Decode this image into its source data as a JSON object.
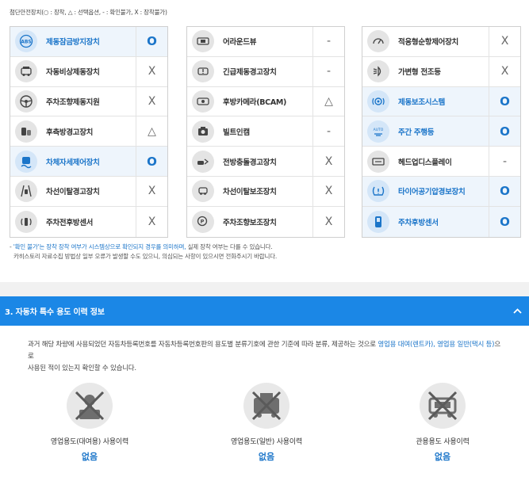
{
  "legend": "첨단안전장치(○ : 장착, △ : 선택옵션, - : 확인불가, X : 장착불가)",
  "columns": [
    {
      "items": [
        {
          "name": "제동잠금방지장치",
          "mark": "O",
          "icon": "abs-icon",
          "highlight": true
        },
        {
          "name": "자동비상제동장치",
          "mark": "X",
          "icon": "emergency-brake-icon",
          "highlight": false
        },
        {
          "name": "주차조향제동지원",
          "mark": "X",
          "icon": "steering-icon",
          "highlight": false
        },
        {
          "name": "후측방경고장치",
          "mark": "△",
          "icon": "rear-side-warning-icon",
          "highlight": false
        },
        {
          "name": "차체자세제어장치",
          "mark": "O",
          "icon": "stability-control-icon",
          "highlight": true
        },
        {
          "name": "차선이탈경고장치",
          "mark": "X",
          "icon": "lane-warning-icon",
          "highlight": false
        },
        {
          "name": "주차전후방센서",
          "mark": "X",
          "icon": "parking-sensor-icon",
          "highlight": false
        }
      ]
    },
    {
      "items": [
        {
          "name": "어라운드뷰",
          "mark": "-",
          "icon": "around-view-icon",
          "highlight": false
        },
        {
          "name": "긴급제동경고장치",
          "mark": "-",
          "icon": "emergency-warning-icon",
          "highlight": false
        },
        {
          "name": "후방카메라(BCAM)",
          "mark": "△",
          "icon": "rear-camera-icon",
          "highlight": false
        },
        {
          "name": "빌트인캠",
          "mark": "-",
          "icon": "builtin-cam-icon",
          "highlight": false
        },
        {
          "name": "전방충돌경고장치",
          "mark": "X",
          "icon": "forward-collision-icon",
          "highlight": false
        },
        {
          "name": "차선이탈보조장치",
          "mark": "X",
          "icon": "lane-assist-icon",
          "highlight": false
        },
        {
          "name": "주차조향보조장치",
          "mark": "X",
          "icon": "parking-assist-icon",
          "highlight": false
        }
      ]
    },
    {
      "items": [
        {
          "name": "적응형순항제어장치",
          "mark": "X",
          "icon": "cruise-control-icon",
          "highlight": false
        },
        {
          "name": "가변형 전조등",
          "mark": "X",
          "icon": "headlamp-icon",
          "highlight": false
        },
        {
          "name": "제동보조시스템",
          "mark": "O",
          "icon": "brake-assist-icon",
          "highlight": true
        },
        {
          "name": "주간 주행등",
          "mark": "O",
          "icon": "daytime-light-icon",
          "highlight": true
        },
        {
          "name": "헤드업디스플레이",
          "mark": "-",
          "icon": "hud-icon",
          "highlight": false
        },
        {
          "name": "타이어공기압경보장치",
          "mark": "O",
          "icon": "tpms-icon",
          "highlight": true
        },
        {
          "name": "주차후방센서",
          "mark": "O",
          "icon": "rear-sensor-icon",
          "highlight": true
        }
      ]
    }
  ],
  "notes": {
    "line1_prefix": "- ",
    "line1_blue": "'확인 불가'는 장착 장착 여부가 시스템상으로 확인되지 경우를 의미하며,",
    "line1_rest": " 실제 장착 여부는 다를 수 있습니다.",
    "line2": "카히스토리 자료수집 방법상 일부 오류가 발생할 수도 있으니, 의심되는 사항이 있으시면 전화주시기 바랍니다."
  },
  "section": {
    "title": "3. 자동차 특수 용도 이력 정보",
    "desc_part1": "과거 해당 차량에 사용되었던 자동차등록번호를 자동차등록번호판의 용도별 분류기호에 관한 기준에 따라 분류, 제공하는 것으로 ",
    "desc_blue": "영업용 대여(렌트카), 영업용 일반(택시 등)",
    "desc_part2": "으로",
    "desc_line2": "사용된 적이 있는지 확인할 수 있습니다."
  },
  "usage": [
    {
      "label": "영업용도(대여용) 사용이력",
      "value": "없음",
      "icon": "rental-key-icon"
    },
    {
      "label": "영업용도(일반) 사용이력",
      "value": "없음",
      "icon": "taxi-icon"
    },
    {
      "label": "관용용도 사용이력",
      "value": "없음",
      "icon": "government-car-icon"
    }
  ],
  "colors": {
    "accent": "#1b87e6",
    "text_blue": "#1b75c9"
  }
}
